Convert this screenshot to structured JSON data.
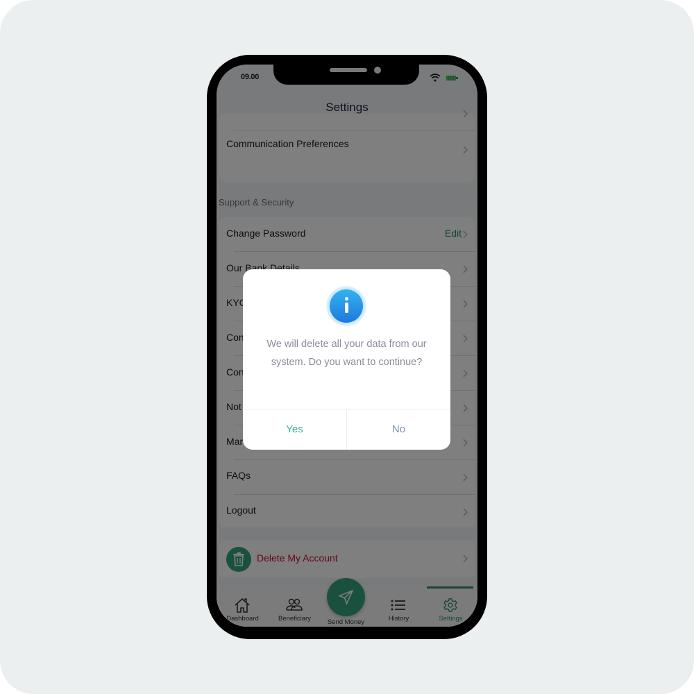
{
  "status_bar": {
    "time": "09.00"
  },
  "header": {
    "title": "Settings"
  },
  "top_card": {
    "items": [
      {
        "label": "Communication Preferences"
      }
    ]
  },
  "support_section": {
    "title": "Support & Security",
    "items": [
      {
        "label": "Change Password",
        "action": "Edit"
      },
      {
        "label": "Our Bank Details"
      },
      {
        "label": "KYC"
      },
      {
        "label": "Con"
      },
      {
        "label": "Con"
      },
      {
        "label": "Not"
      },
      {
        "label": "Mar"
      },
      {
        "label": "FAQs"
      },
      {
        "label": "Logout"
      }
    ]
  },
  "delete_account": {
    "label": "Delete My Account",
    "color": "#c8102e"
  },
  "tabbar": {
    "tabs": [
      {
        "label": "Dashboard",
        "icon": "home-icon"
      },
      {
        "label": "Beneficiary",
        "icon": "users-icon"
      },
      {
        "label": "Send Money",
        "icon": "send-icon"
      },
      {
        "label": "History",
        "icon": "list-icon"
      },
      {
        "label": "Settings",
        "icon": "gear-icon",
        "active": true
      }
    ],
    "accent": "#2e8b6a"
  },
  "dialog": {
    "icon": "info-icon",
    "message": "We will delete all your data from our system. Do you want to continue?",
    "yes_label": "Yes",
    "no_label": "No"
  }
}
